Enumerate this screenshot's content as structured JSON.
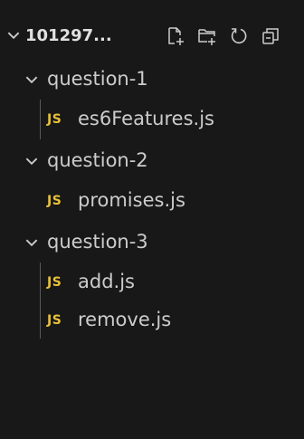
{
  "explorer": {
    "root_label": "101297...",
    "actions": [
      {
        "name": "new-file-icon"
      },
      {
        "name": "new-folder-icon"
      },
      {
        "name": "refresh-icon"
      },
      {
        "name": "collapse-all-icon"
      }
    ],
    "folders": [
      {
        "label": "question-1",
        "files": [
          {
            "label": "es6Features.js",
            "badge": "JS"
          }
        ]
      },
      {
        "label": "question-2",
        "files": [
          {
            "label": "promises.js",
            "badge": "JS"
          }
        ]
      },
      {
        "label": "question-3",
        "files": [
          {
            "label": "add.js",
            "badge": "JS"
          },
          {
            "label": "remove.js",
            "badge": "JS"
          }
        ]
      }
    ]
  },
  "colors": {
    "background": "#181818",
    "text": "#cccccc",
    "js_badge": "#e8c13b",
    "indent_guide": "#585858"
  }
}
